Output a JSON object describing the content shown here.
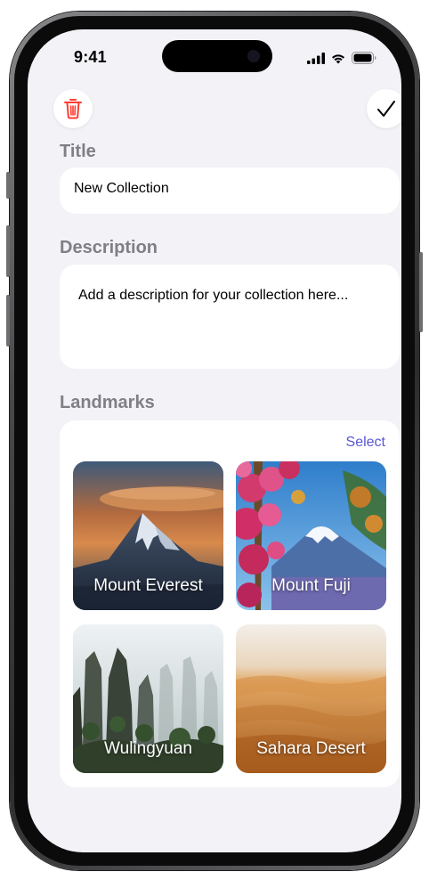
{
  "status_bar": {
    "time": "9:41"
  },
  "toolbar": {
    "delete_icon": "trash-icon",
    "done_icon": "checkmark-icon",
    "delete_color": "#ff3b30"
  },
  "title_section": {
    "label": "Title",
    "value": "New Collection"
  },
  "description_section": {
    "label": "Description",
    "placeholder": "Add a description for your collection here..."
  },
  "landmarks_section": {
    "label": "Landmarks",
    "select_label": "Select",
    "accent_color": "#5856d6",
    "items": [
      {
        "name": "Mount Everest"
      },
      {
        "name": "Mount Fuji"
      },
      {
        "name": "Wulingyuan"
      },
      {
        "name": "Sahara Desert"
      }
    ]
  }
}
